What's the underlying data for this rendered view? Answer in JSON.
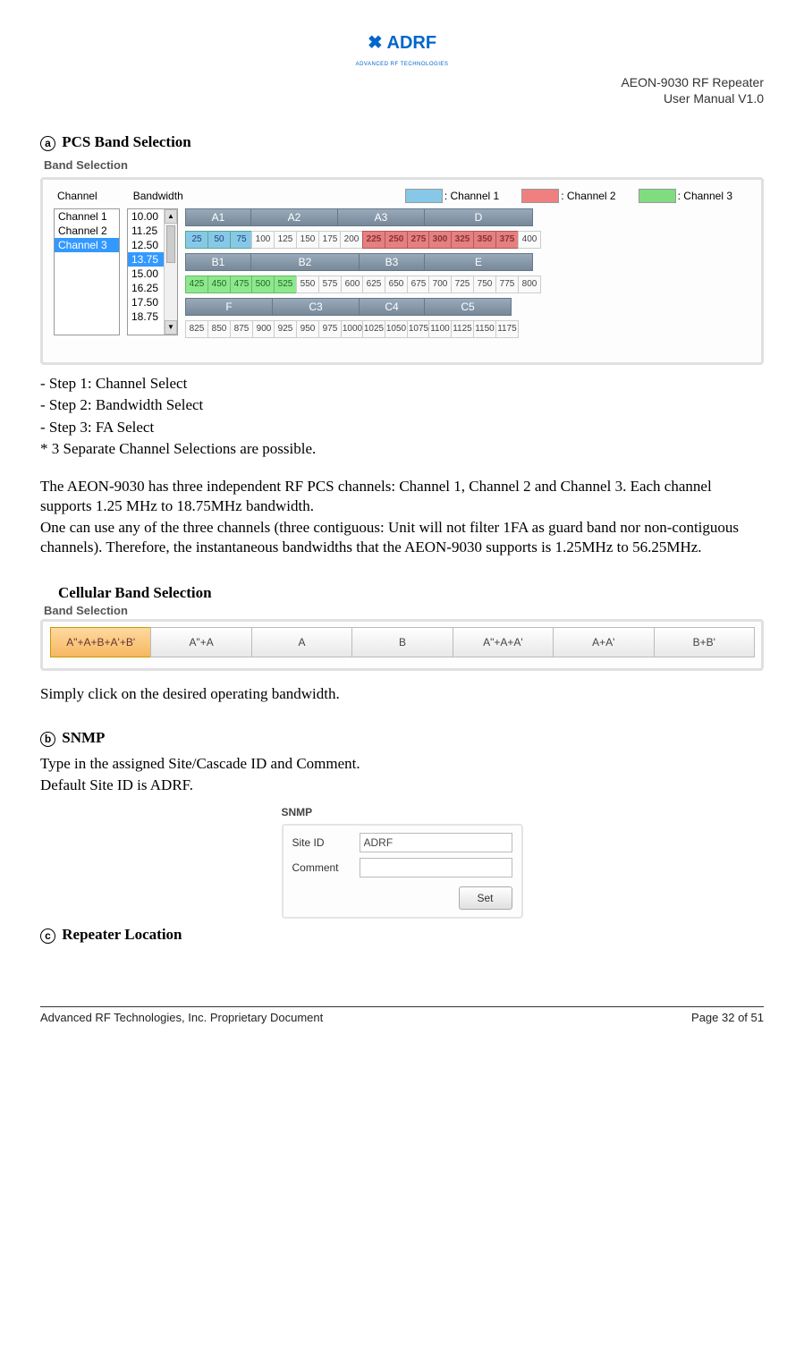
{
  "header": {
    "line1": "AEON-9030 RF Repeater",
    "line2": "User Manual V1.0",
    "logo_main": "ADRF",
    "logo_sub": "ADVANCED RF TECHNOLOGIES"
  },
  "section_a": {
    "marker": "a",
    "title": "PCS Band Selection",
    "panel_title": "Band Selection",
    "ch_label": "Channel",
    "bw_label": "Bandwidth",
    "legend": {
      "ch1": ": Channel 1",
      "ch2": ": Channel 2",
      "ch3": ": Channel 3"
    },
    "channels": [
      "Channel 1",
      "Channel 2",
      "Channel 3"
    ],
    "channel_selected": "Channel 3",
    "bandwidths": [
      "10.00",
      "11.25",
      "12.50",
      "13.75",
      "15.00",
      "16.25",
      "17.50",
      "18.75"
    ],
    "bandwidth_selected": "13.75",
    "fa_rows": [
      {
        "blocks": [
          {
            "name": "A1",
            "cells": [
              "25",
              "50",
              "75"
            ],
            "class": "ch1"
          },
          {
            "name": "A2",
            "cells": [
              "100",
              "125",
              "150",
              "175"
            ],
            "class": ""
          },
          {
            "name": "A3",
            "cells": [
              "200",
              "225",
              "250",
              "275"
            ],
            "class": "",
            "cell_classes": [
              "",
              "ch2",
              "ch2",
              "ch2"
            ]
          },
          {
            "name": "D",
            "cells": [
              "300",
              "325",
              "350",
              "375",
              "400"
            ],
            "class": "",
            "cell_classes": [
              "ch2",
              "ch2",
              "ch2",
              "ch2",
              ""
            ]
          }
        ]
      },
      {
        "blocks": [
          {
            "name": "B1",
            "cells": [
              "425",
              "450",
              "475"
            ],
            "class": "ch3"
          },
          {
            "name": "B2",
            "cells": [
              "500",
              "525",
              "550",
              "575",
              "600"
            ],
            "class": "",
            "cell_classes": [
              "ch3",
              "ch3",
              "",
              "",
              ""
            ]
          },
          {
            "name": "B3",
            "cells": [
              "625",
              "650",
              "675"
            ],
            "class": ""
          },
          {
            "name": "E",
            "cells": [
              "700",
              "725",
              "750",
              "775",
              "800"
            ],
            "class": ""
          }
        ]
      },
      {
        "blocks": [
          {
            "name": "F",
            "cells": [
              "825",
              "850",
              "875",
              "900"
            ],
            "class": ""
          },
          {
            "name": "C3",
            "cells": [
              "925",
              "950",
              "975",
              "1000"
            ],
            "class": ""
          },
          {
            "name": "C4",
            "cells": [
              "1025",
              "1050",
              "1075"
            ],
            "class": ""
          },
          {
            "name": "C5",
            "cells": [
              "1100",
              "1125",
              "1150",
              "1175"
            ],
            "class": ""
          }
        ]
      }
    ],
    "steps": [
      "- Step 1: Channel Select",
      "- Step 2: Bandwidth Select",
      "- Step 3: FA Select"
    ],
    "note": "* 3 Separate Channel Selections are possible.",
    "para1": "The AEON-9030 has three independent RF PCS channels: Channel 1, Channel 2 and Channel 3. Each channel supports 1.25 MHz to 18.75MHz bandwidth.",
    "para2": "One can use any of the three channels (three contiguous: Unit will not filter 1FA as guard band nor non-contiguous channels). Therefore, the instantaneous bandwidths that the AEON-9030 supports is 1.25MHz to 56.25MHz."
  },
  "cellular": {
    "title": "Cellular Band Selection",
    "panel_title": "Band Selection",
    "buttons": [
      "A\"+A+B+A'+B'",
      "A\"+A",
      "A",
      "B",
      "A\"+A+A'",
      "A+A'",
      "B+B'"
    ],
    "selected": 0,
    "text": "Simply click on the desired operating bandwidth."
  },
  "section_b": {
    "marker": "b",
    "title": "SNMP",
    "line1": "Type in the assigned Site/Cascade ID and Comment.",
    "line2": "Default Site ID is ADRF.",
    "panel_title": "SNMP",
    "site_label": "Site ID",
    "site_value": "ADRF",
    "comment_label": "Comment",
    "comment_value": "",
    "set_label": "Set"
  },
  "section_c": {
    "marker": "c",
    "title": "Repeater Location"
  },
  "footer": {
    "left": "Advanced RF Technologies, Inc. Proprietary Document",
    "right": "Page 32 of 51"
  }
}
